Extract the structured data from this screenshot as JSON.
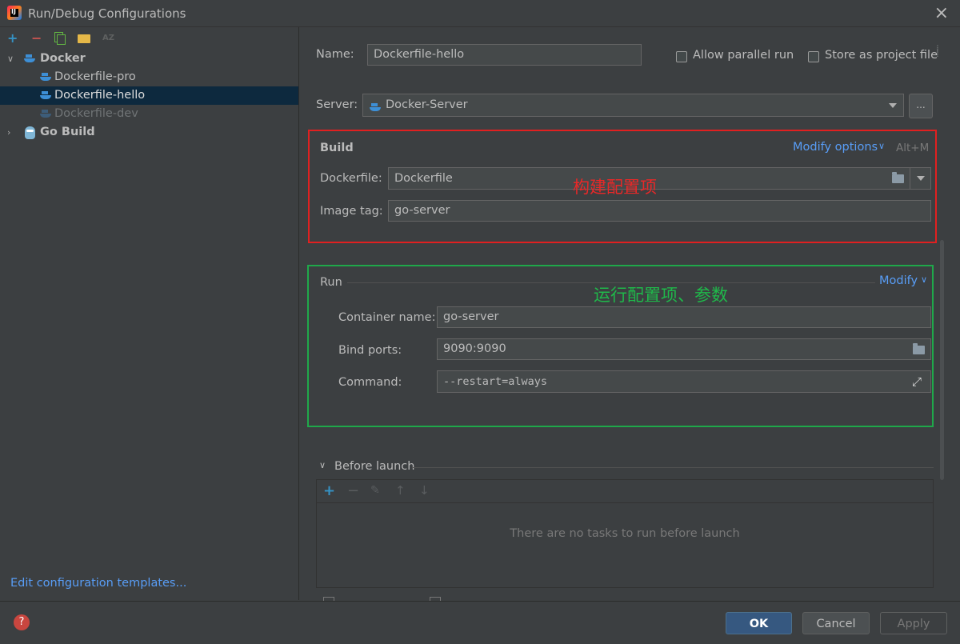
{
  "window": {
    "title": "Run/Debug Configurations",
    "app_icon_letter": "IJ"
  },
  "toolbar": {
    "add": "+",
    "remove": "−",
    "sort": "AZ"
  },
  "tree": {
    "docker": {
      "label": "Docker"
    },
    "items": [
      {
        "label": "Dockerfile-pro"
      },
      {
        "label": "Dockerfile-hello"
      },
      {
        "label": "Dockerfile-dev"
      }
    ],
    "go_build": {
      "label": "Go Build"
    }
  },
  "edit_templates": "Edit configuration templates...",
  "form": {
    "name_label": "Name:",
    "name_value": "Dockerfile-hello",
    "allow_parallel": "Allow parallel run",
    "store_project": "Store as project file",
    "server_label": "Server:",
    "server_value": "Docker-Server",
    "server_more": "...",
    "build": {
      "title": "Build",
      "modify_options": "Modify options",
      "shortcut": "Alt+M",
      "dockerfile_label": "Dockerfile:",
      "dockerfile_value": "Dockerfile",
      "image_tag_label": "Image tag:",
      "image_tag_value": "go-server",
      "annotation": "构建配置项"
    },
    "run": {
      "title": "Run",
      "modify": "Modify",
      "annotation": "运行配置项、参数",
      "container_label": "Container name:",
      "container_value": "go-server",
      "ports_label": "Bind ports:",
      "ports_value": "9090:9090",
      "command_label": "Command:",
      "command_value": "--restart=always"
    },
    "before_launch": {
      "title": "Before launch",
      "empty_text": "There are no tasks to run before launch"
    }
  },
  "buttons": {
    "ok": "OK",
    "cancel": "Cancel",
    "apply": "Apply",
    "help": "?"
  },
  "colors": {
    "accent": "#589df6",
    "selection": "#0d293e",
    "ok_button": "#365880",
    "annotation_red": "#e02020",
    "annotation_green": "#1fa84a"
  }
}
